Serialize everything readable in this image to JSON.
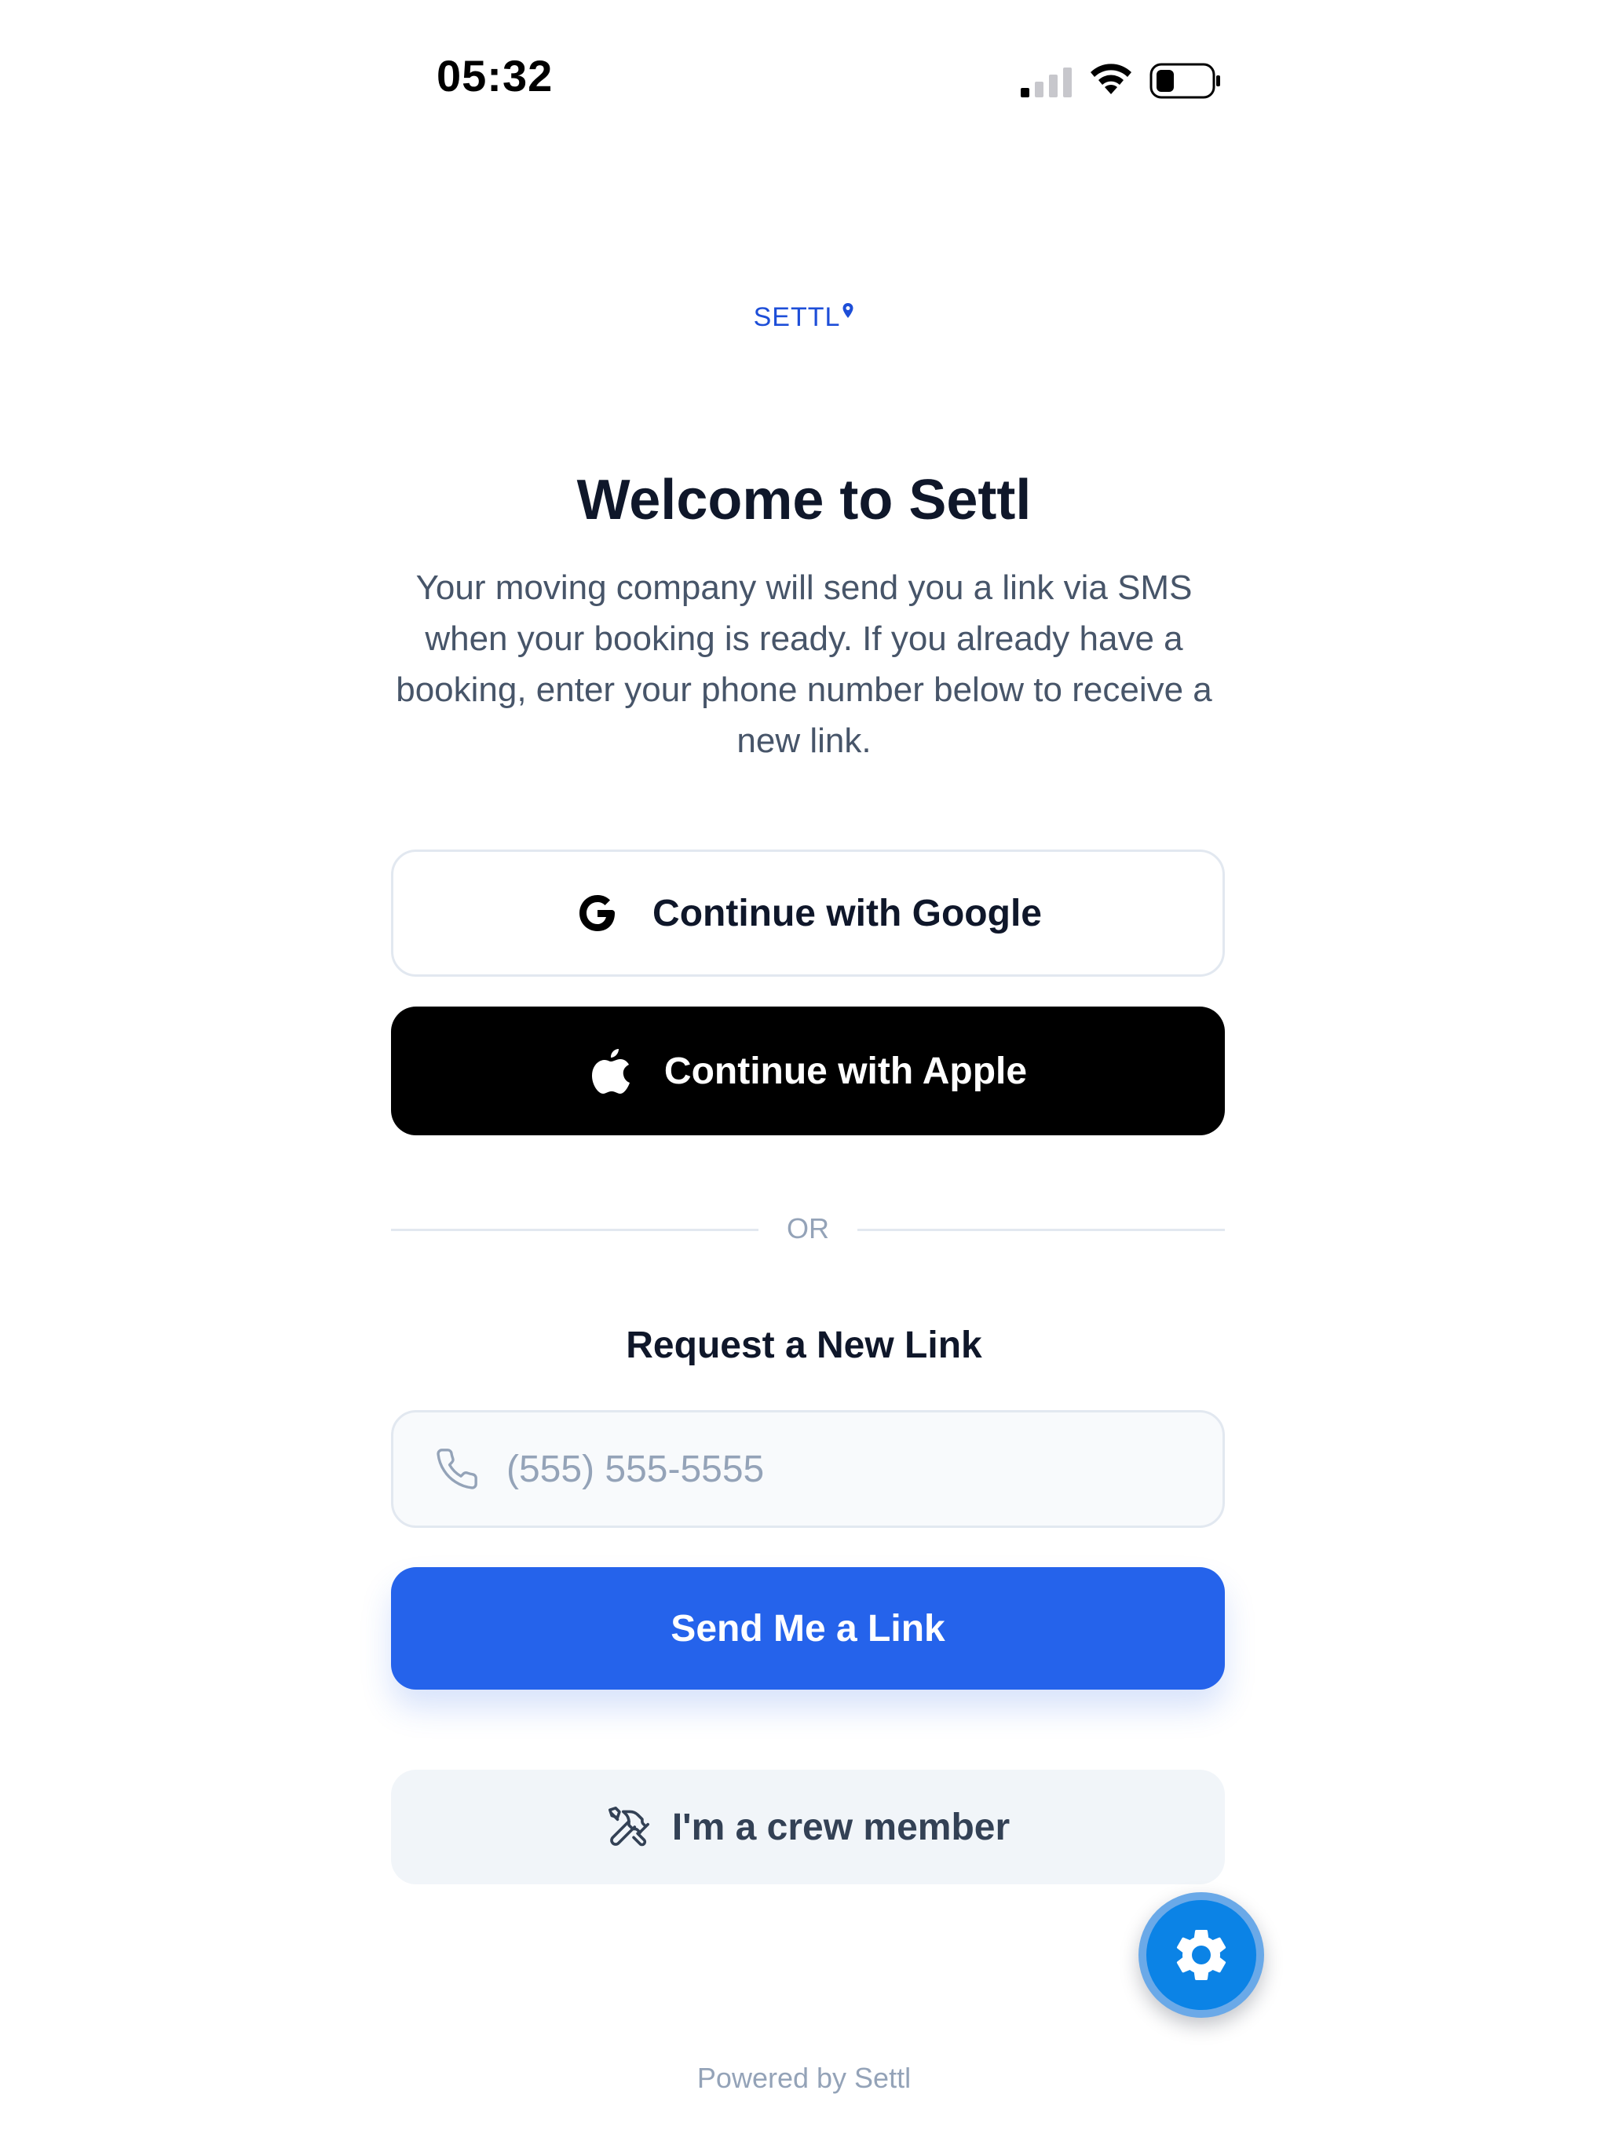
{
  "status_bar": {
    "time": "05:32",
    "icons": [
      "cellular-signal-icon",
      "wifi-icon",
      "battery-icon"
    ]
  },
  "brand": {
    "name": "SETTL",
    "color": "#1d4ed8"
  },
  "welcome": {
    "title": "Welcome to Settl",
    "description": "Your moving company will send you a link via SMS when your booking is ready. If you already have a booking, enter your phone number below to receive a new link."
  },
  "auth": {
    "google_label": "Continue with Google",
    "apple_label": "Continue with Apple",
    "divider_text": "OR"
  },
  "request_link": {
    "heading": "Request a New Link",
    "phone_value": "",
    "phone_placeholder": "(555) 555-5555",
    "submit_label": "Send Me a Link"
  },
  "crew": {
    "label": "I'm a crew member"
  },
  "footer": {
    "text": "Powered by Settl"
  },
  "colors": {
    "primary": "#2563eb",
    "fab": "#0b83e6",
    "text_dark": "#0f172a",
    "text_muted": "#475569",
    "text_faint": "#94a3b8"
  }
}
